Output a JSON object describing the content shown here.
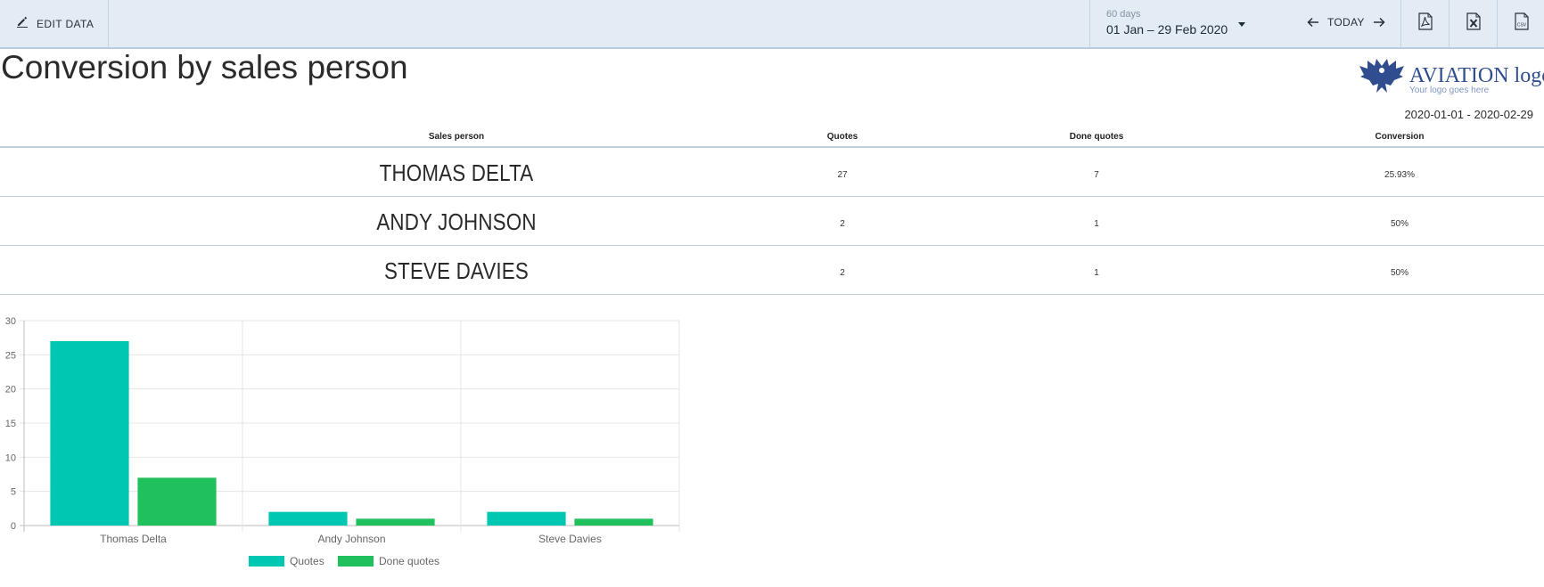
{
  "toolbar": {
    "edit_label": "EDIT DATA",
    "date_range": {
      "days": "60 days",
      "range": "01 Jan – 29 Feb 2020"
    },
    "today_label": "TODAY",
    "exports": [
      {
        "icon": "pdf-icon"
      },
      {
        "icon": "excel-icon"
      },
      {
        "icon": "csv-icon",
        "label": "CSV"
      }
    ]
  },
  "page": {
    "title": "Conversion by sales person",
    "period": "2020-01-01 - 2020-02-29"
  },
  "logo": {
    "name": "AVIATION logo",
    "tagline": "Your logo goes here",
    "brand_color": "#2f4d8f"
  },
  "table": {
    "headers": [
      "Sales person",
      "Quotes",
      "Done quotes",
      "Conversion"
    ],
    "rows": [
      {
        "name": "THOMAS DELTA",
        "quotes": "27",
        "done": "7",
        "conversion": "25.93%"
      },
      {
        "name": "ANDY JOHNSON",
        "quotes": "2",
        "done": "1",
        "conversion": "50%"
      },
      {
        "name": "STEVE DAVIES",
        "quotes": "2",
        "done": "1",
        "conversion": "50%"
      }
    ]
  },
  "chart_data": {
    "type": "bar",
    "categories": [
      "Thomas Delta",
      "Andy Johnson",
      "Steve Davies"
    ],
    "series": [
      {
        "name": "Quotes",
        "values": [
          27,
          2,
          2
        ],
        "color": "#00c7b1"
      },
      {
        "name": "Done quotes",
        "values": [
          7,
          1,
          1
        ],
        "color": "#20c05c"
      }
    ],
    "yticks": [
      0,
      5,
      10,
      15,
      20,
      25,
      30
    ],
    "ylim": [
      0,
      30
    ],
    "grid": true,
    "legend": "bottom"
  }
}
